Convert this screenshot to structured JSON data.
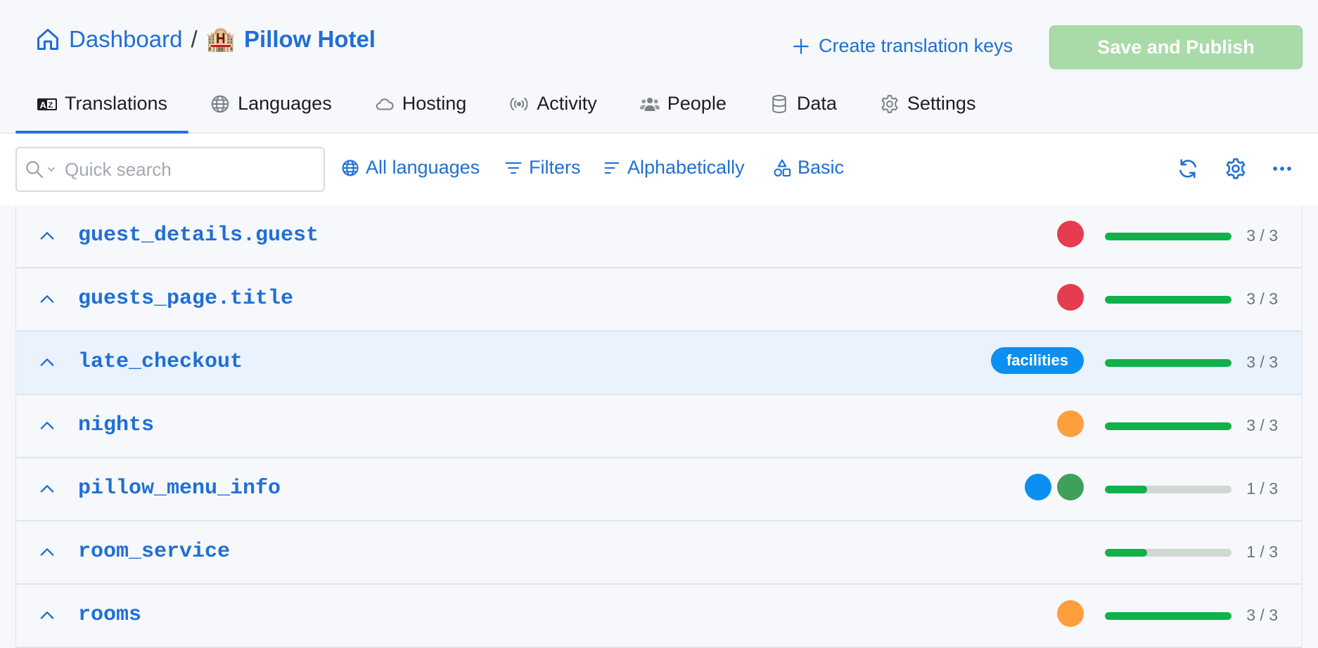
{
  "breadcrumb": {
    "dashboard": "Dashboard",
    "separator": "/",
    "hotel_emoji": "🏨",
    "project": "Pillow Hotel"
  },
  "header": {
    "create_keys_label": "Create translation keys",
    "publish_label": "Save and Publish"
  },
  "tabs": [
    {
      "label": "Translations",
      "icon": "translate-icon",
      "active": true
    },
    {
      "label": "Languages",
      "icon": "globe-icon",
      "active": false
    },
    {
      "label": "Hosting",
      "icon": "cloud-icon",
      "active": false
    },
    {
      "label": "Activity",
      "icon": "broadcast-icon",
      "active": false
    },
    {
      "label": "People",
      "icon": "people-icon",
      "active": false
    },
    {
      "label": "Data",
      "icon": "database-icon",
      "active": false
    },
    {
      "label": "Settings",
      "icon": "gear-icon",
      "active": false
    }
  ],
  "toolbar": {
    "search_placeholder": "Quick search",
    "languages_label": "All languages",
    "filters_label": "Filters",
    "sort_label": "Alphabetically",
    "view_label": "Basic"
  },
  "colors": {
    "accent": "#1f6fd6",
    "progress": "#10b14a",
    "red": "#e63c4f",
    "orange": "#ff9e3d",
    "blue": "#0b8ff0",
    "green": "#3fa05a",
    "publish": "#a8dba8"
  },
  "rows": [
    {
      "key": "guest_details.guest",
      "badges": [
        {
          "type": "dot",
          "color": "#e63c4f"
        }
      ],
      "progress": 1.0,
      "count": "3 / 3",
      "selected": false
    },
    {
      "key": "guests_page.title",
      "badges": [
        {
          "type": "dot",
          "color": "#e63c4f"
        }
      ],
      "progress": 1.0,
      "count": "3 / 3",
      "selected": false
    },
    {
      "key": "late_checkout",
      "badges": [
        {
          "type": "tag",
          "label": "facilities",
          "color": "#0b8ff0"
        }
      ],
      "progress": 1.0,
      "count": "3 / 3",
      "selected": true
    },
    {
      "key": "nights",
      "badges": [
        {
          "type": "dot",
          "color": "#ff9e3d"
        }
      ],
      "progress": 1.0,
      "count": "3 / 3",
      "selected": false
    },
    {
      "key": "pillow_menu_info",
      "badges": [
        {
          "type": "dot",
          "color": "#0b8ff0"
        },
        {
          "type": "dot",
          "color": "#3fa05a"
        }
      ],
      "progress": 0.3333,
      "count": "1 / 3",
      "selected": false
    },
    {
      "key": "room_service",
      "badges": [],
      "progress": 0.3333,
      "count": "1 / 3",
      "selected": false
    },
    {
      "key": "rooms",
      "badges": [
        {
          "type": "dot",
          "color": "#ff9e3d"
        }
      ],
      "progress": 1.0,
      "count": "3 / 3",
      "selected": false
    }
  ]
}
